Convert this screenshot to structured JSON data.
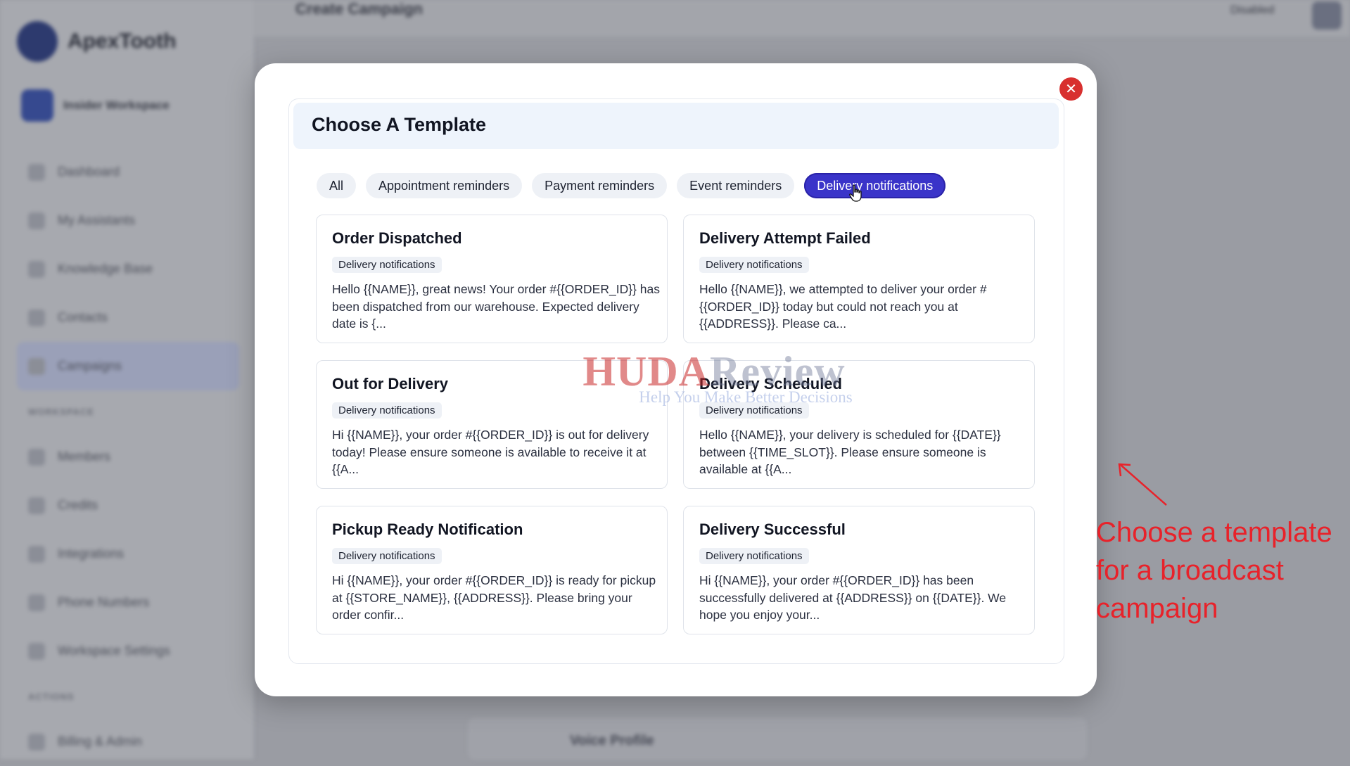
{
  "background": {
    "brand": "ApexTooth",
    "workspace": "Insider Workspace",
    "page_title": "Create Campaign",
    "top_button": "Disabled",
    "nav_items": [
      "Dashboard",
      "My Assistants",
      "Knowledge Base",
      "Contacts",
      "Campaigns"
    ],
    "section_workspace": "WORKSPACE",
    "nav_items_2": [
      "Members",
      "Credits",
      "Integrations",
      "Phone Numbers",
      "Workspace Settings"
    ],
    "section_actions": "ACTIONS",
    "nav_items_3": [
      "Billing & Admin"
    ],
    "bottom_card_title": "Voice Profile"
  },
  "modal": {
    "title": "Choose A Template",
    "close_icon": "close-icon",
    "filters": [
      {
        "label": "All",
        "active": false
      },
      {
        "label": "Appointment reminders",
        "active": false
      },
      {
        "label": "Payment reminders",
        "active": false
      },
      {
        "label": "Event reminders",
        "active": false
      },
      {
        "label": "Delivery notifications",
        "active": true
      }
    ],
    "templates": [
      {
        "title": "Order Dispatched",
        "badge": "Delivery notifications",
        "body": "Hello {{NAME}}, great news! Your order #{{ORDER_ID}} has been dispatched from our warehouse. Expected delivery date is {..."
      },
      {
        "title": "Delivery Attempt Failed",
        "badge": "Delivery notifications",
        "body": "Hello {{NAME}}, we attempted to deliver your order #{{ORDER_ID}} today but could not reach you at {{ADDRESS}}. Please ca..."
      },
      {
        "title": "Out for Delivery",
        "badge": "Delivery notifications",
        "body": "Hi {{NAME}}, your order #{{ORDER_ID}} is out for delivery today! Please ensure someone is available to receive it at {{A..."
      },
      {
        "title": "Delivery Scheduled",
        "badge": "Delivery notifications",
        "body": "Hello {{NAME}}, your delivery is scheduled for {{DATE}} between {{TIME_SLOT}}. Please ensure someone is available at {{A..."
      },
      {
        "title": "Pickup Ready Notification",
        "badge": "Delivery notifications",
        "body": "Hi {{NAME}}, your order #{{ORDER_ID}} is ready for pickup at {{STORE_NAME}}, {{ADDRESS}}. Please bring your order confir..."
      },
      {
        "title": "Delivery Successful",
        "badge": "Delivery notifications",
        "body": "Hi {{NAME}}, your order #{{ORDER_ID}} has been successfully delivered at {{ADDRESS}} on {{DATE}}. We hope you enjoy your..."
      }
    ]
  },
  "watermark": {
    "part1": "HUDA",
    "part2": "Review",
    "tagline": "Help You Make Better Decisions"
  },
  "annotation": {
    "text": "Choose a template for a broadcast campaign"
  },
  "colors": {
    "accent": "#3a34c9",
    "close": "#d8302f",
    "annotation": "#e8222a"
  }
}
